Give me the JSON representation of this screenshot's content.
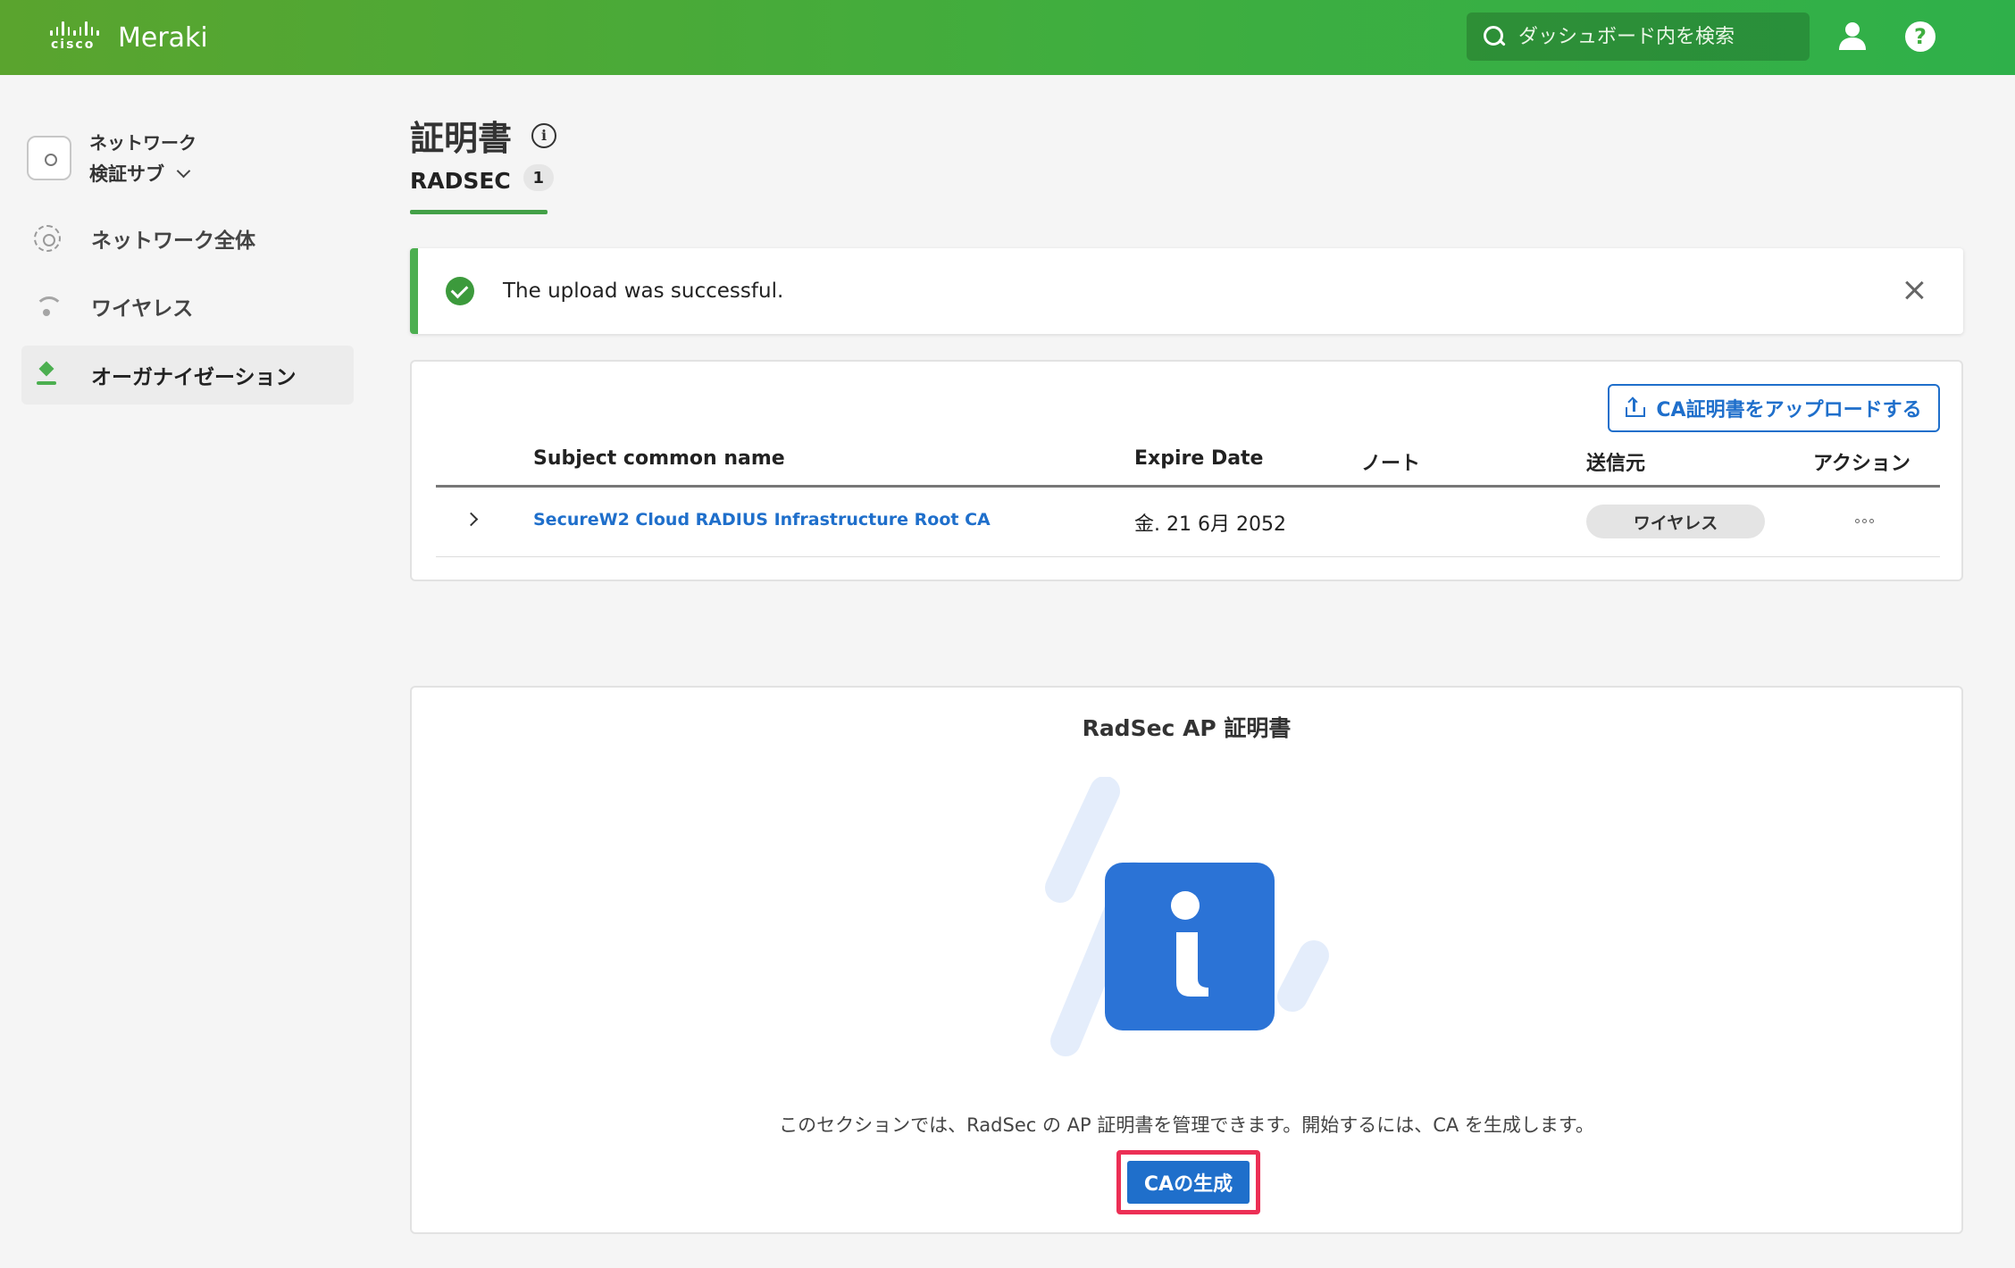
{
  "header": {
    "brand": "cisco",
    "product": "Meraki",
    "search_placeholder": "ダッシュボード内を検索",
    "help_glyph": "?"
  },
  "sidebar": {
    "network_label_line1": "ネットワーク",
    "network_label_line2": "検証サブ",
    "items": [
      {
        "label": "ネットワーク全体",
        "icon": "globe-icon"
      },
      {
        "label": "ワイヤレス",
        "icon": "wifi-icon"
      },
      {
        "label": "オーガナイゼーション",
        "icon": "organization-icon",
        "active": true
      }
    ]
  },
  "main": {
    "title": "証明書",
    "info_glyph": "i",
    "tab": {
      "label": "RADSEC",
      "count": "1"
    },
    "alert": {
      "message": "The upload was successful."
    },
    "table": {
      "upload_button": "CA証明書をアップロードする",
      "columns": [
        "Subject common name",
        "Expire Date",
        "ノート",
        "送信元",
        "アクション"
      ],
      "rows": [
        {
          "name": "SecureW2 Cloud RADIUS Infrastructure Root CA",
          "expire": "金. 21 6月 2052",
          "note": "",
          "source": "ワイヤレス"
        }
      ]
    },
    "radsec_ap": {
      "title": "RadSec AP 証明書",
      "description": "このセクションでは、RadSec の AP 証明書を管理できます。開始するには、CA を生成します。",
      "generate_button": "CAの生成"
    }
  },
  "colors": {
    "header_green": "#3fae3f",
    "accent_blue": "#1f6fcb",
    "success_green": "#4caf50",
    "highlight_red": "#ec2f55"
  }
}
